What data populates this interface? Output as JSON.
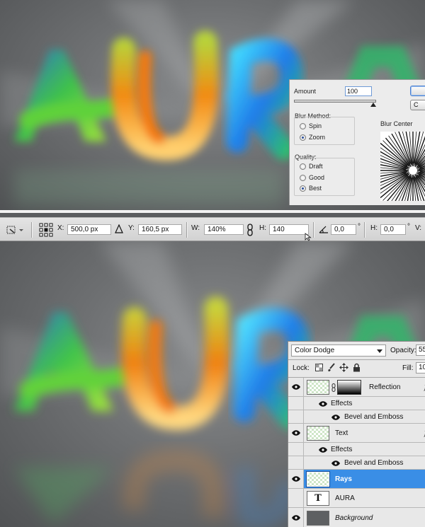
{
  "artwork": {
    "text": "AURA"
  },
  "radial_blur": {
    "amount_label": "Amount",
    "amount_value": "100",
    "amount_slider_fraction": 1.0,
    "ok_label": "",
    "cancel_label": "C",
    "blur_method_label": "Blur Method:",
    "methods": [
      {
        "label": "Spin",
        "selected": false
      },
      {
        "label": "Zoom",
        "selected": true
      }
    ],
    "quality_label": "Quality:",
    "qualities": [
      {
        "label": "Draft",
        "selected": false
      },
      {
        "label": "Good",
        "selected": false
      },
      {
        "label": "Best",
        "selected": true
      }
    ],
    "blur_center_label": "Blur Center"
  },
  "options_bar": {
    "x_label": "X:",
    "x_value": "500,0 px",
    "y_label": "Y:",
    "y_value": "160,5 px",
    "w_label": "W:",
    "w_value": "140%",
    "h_label": "H:",
    "h_value": "140",
    "angle_value": "0,0",
    "angle_unit": "°",
    "hskew_label": "H:",
    "hskew_value": "0,0",
    "hskew_unit": "°",
    "vskew_label": "V:"
  },
  "layers_panel": {
    "blend_mode": "Color Dodge",
    "opacity_label": "Opacity:",
    "opacity_value": "55",
    "lock_label": "Lock:",
    "fill_label": "Fill:",
    "fill_value": "10",
    "layers": [
      {
        "name": "Reflection",
        "visible": true,
        "has_mask": true,
        "fx": "f"
      },
      {
        "name": "Effects",
        "kind": "effects-header",
        "visible": true
      },
      {
        "name": "Bevel and Emboss",
        "kind": "effect",
        "visible": true
      },
      {
        "name": "Text",
        "visible": true,
        "fx": "f"
      },
      {
        "name": "Effects",
        "kind": "effects-header",
        "visible": true
      },
      {
        "name": "Bevel and Emboss",
        "kind": "effect",
        "visible": true
      },
      {
        "name": "Rays",
        "visible": true,
        "selected": true
      },
      {
        "name": "AURA",
        "visible": false,
        "type_layer_glyph": "T"
      },
      {
        "name": "Background",
        "visible": true,
        "italic": true
      }
    ]
  },
  "colors": {
    "selection_blue": "#3a8ee6",
    "panel_bg": "#e8e8e8",
    "canvas_gray": "#6e7072"
  }
}
